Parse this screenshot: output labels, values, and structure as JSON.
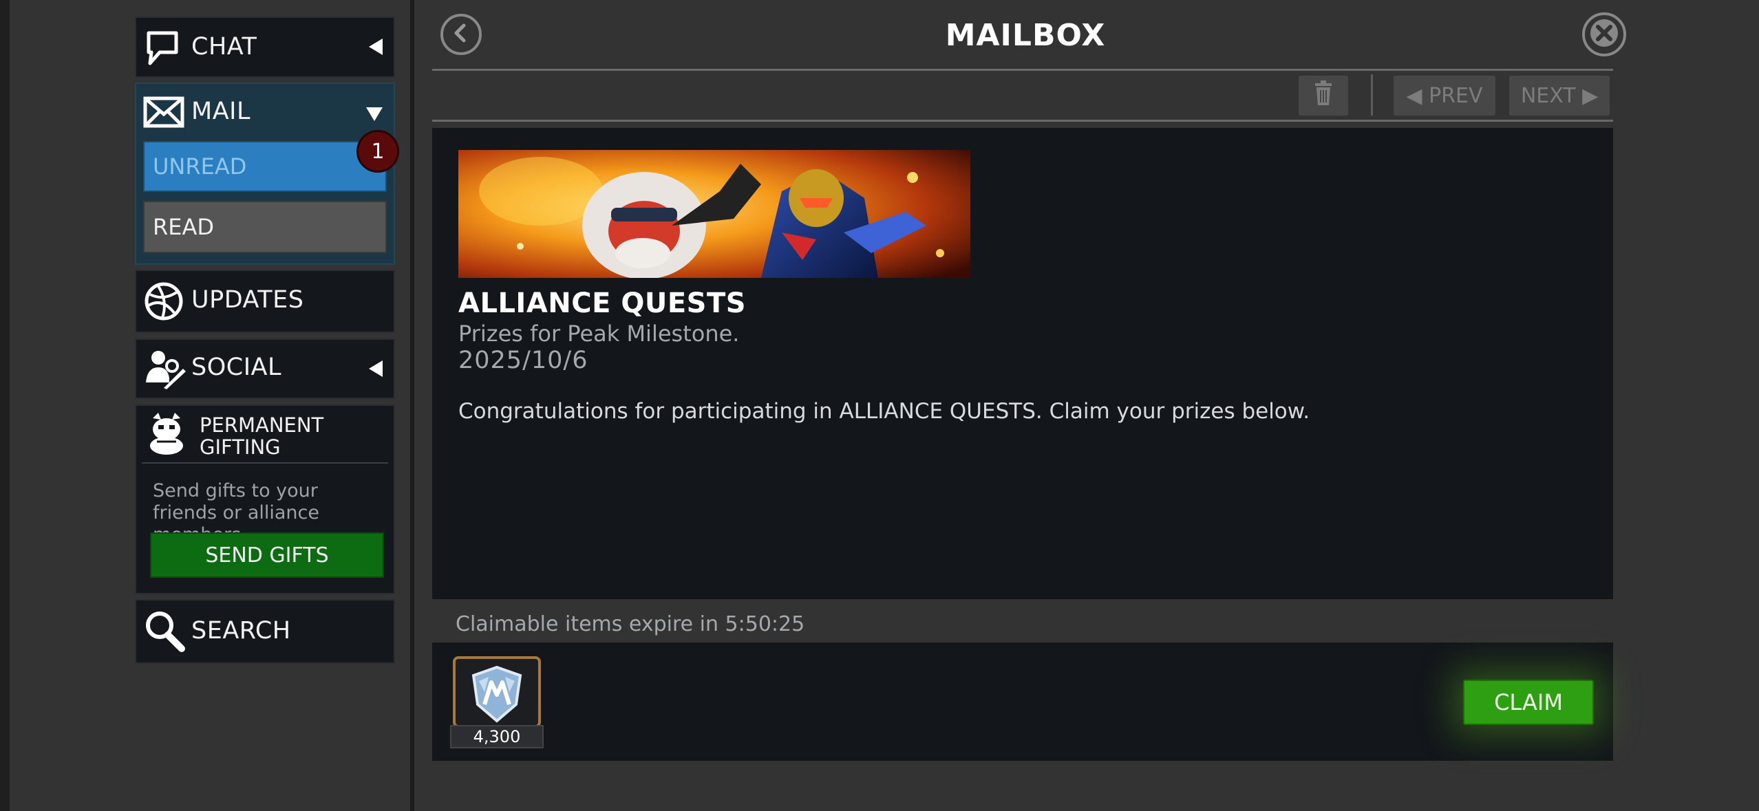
{
  "sidebar": {
    "chat": {
      "label": "CHAT",
      "icon": "speech-bubble-icon",
      "state": "collapsed"
    },
    "mail": {
      "label": "MAIL",
      "icon": "envelope-icon",
      "state": "expanded",
      "unread": {
        "label": "UNREAD",
        "badge": "1"
      },
      "read": {
        "label": "READ"
      }
    },
    "updates": {
      "label": "UPDATES",
      "icon": "globe-icon"
    },
    "social": {
      "label": "SOCIAL",
      "icon": "users-icon",
      "state": "collapsed"
    },
    "gifting": {
      "title": "PERMANENT GIFTING",
      "icon": "gifting-mascot-icon",
      "description": "Send gifts to your friends or alliance members.",
      "button": "SEND GIFTS"
    },
    "search": {
      "label": "SEARCH",
      "icon": "magnifier-icon"
    }
  },
  "header": {
    "title": "MAILBOX",
    "back_icon": "back-arrow-icon",
    "close_icon": "close-x-icon"
  },
  "toolbar": {
    "delete_icon": "trash-icon",
    "prev": "◀ PREV",
    "next": "NEXT ▶"
  },
  "message": {
    "banner": "alliance-quests-banner-image",
    "title": "ALLIANCE QUESTS",
    "subtitle": "Prizes for Peak Milestone.",
    "date": "2025/10/6",
    "body": "Congratulations for participating in ALLIANCE QUESTS. Claim your prizes below."
  },
  "claim": {
    "expiry": "Claimable items expire in 5:50:25",
    "reward": {
      "icon": "alliance-shield-icon",
      "count": "4,300"
    },
    "button": "CLAIM"
  },
  "colors": {
    "background": "#333333",
    "panel": "#13161b",
    "mail_section": "#1b3644",
    "unread_button": "#2b7fc0",
    "send_gifts": "#0d6b12",
    "claim": "#2e9e12",
    "badge": "#5a0a0a"
  }
}
